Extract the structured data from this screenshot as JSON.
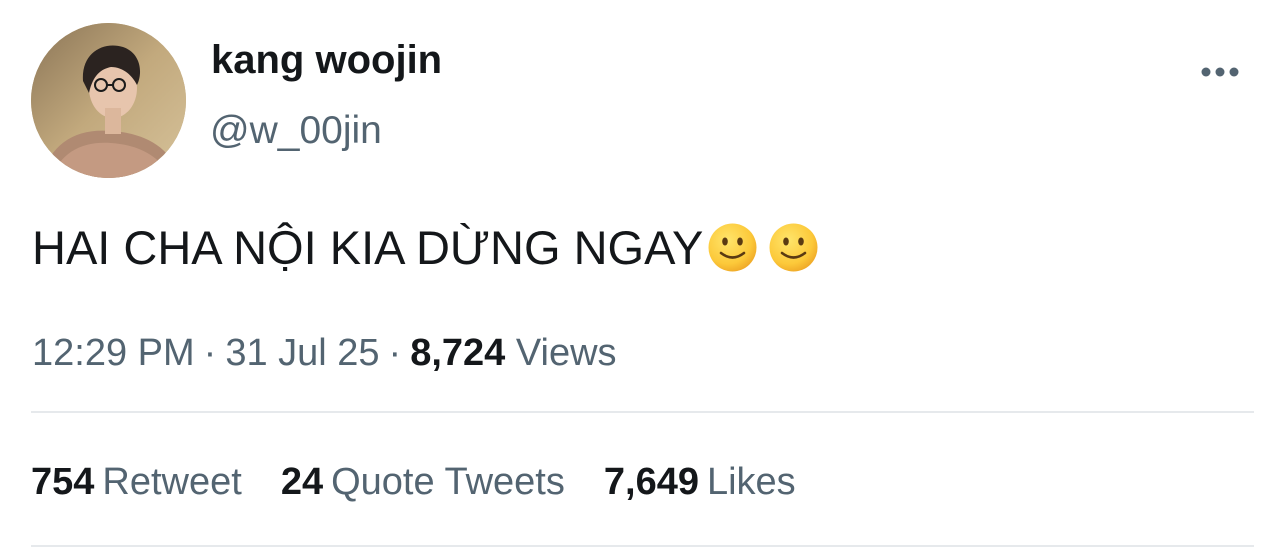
{
  "author": {
    "display_name": "kang woojin",
    "handle": "@w_00jin"
  },
  "tweet": {
    "text": "HAI CHA NỘI KIA DỪNG NGAY",
    "emojis": [
      "slightly-smiling-face-emoji",
      "slightly-smiling-face-emoji"
    ]
  },
  "meta": {
    "time": "12:29 PM",
    "separator": "·",
    "date": "31 Jul 25",
    "views_count": "8,724",
    "views_label": "Views"
  },
  "stats": [
    {
      "count": "754",
      "label": "Retweet"
    },
    {
      "count": "24",
      "label": "Quote Tweets"
    },
    {
      "count": "7,649",
      "label": "Likes"
    }
  ],
  "icons": {
    "more": "more-options-icon"
  },
  "colors": {
    "primary_text": "#14171a",
    "secondary_text": "#536471",
    "divider": "#e6e9ec"
  }
}
